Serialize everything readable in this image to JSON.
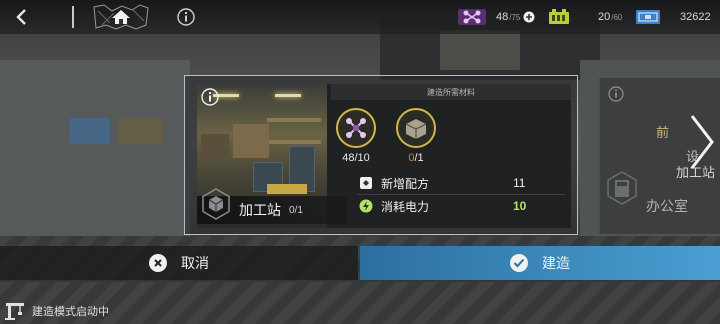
{
  "topbar": {
    "resource1": {
      "value": "48",
      "max": "/75",
      "icon": "drone-icon"
    },
    "resource2": {
      "value": "20",
      "max": "/60",
      "icon": "battery-icon"
    },
    "resource3": {
      "value": "32622",
      "icon": "currency-icon"
    }
  },
  "dialog": {
    "header": "建造所需材料",
    "materials": [
      {
        "count": "48/10",
        "icon": "drone-material-icon"
      },
      {
        "count_current": "0",
        "count_required": "/1",
        "icon": "crate-material-icon"
      }
    ],
    "facility_name": "加工站",
    "facility_level": "0/1",
    "stats": [
      {
        "label": "新增配方",
        "value": "11",
        "icon": "recipe-icon"
      },
      {
        "label": "消耗电力",
        "value": "10",
        "icon": "power-icon"
      }
    ]
  },
  "next_card": {
    "line1": "前",
    "line2": "设",
    "line3": "加工站",
    "name": "办公室"
  },
  "actions": {
    "cancel_label": "取消",
    "build_label": "建造"
  },
  "status": {
    "text": "建造模式启动中"
  },
  "colors": {
    "accent_blue": "#4a9fd3",
    "power_green": "#b7e16a",
    "material_red": "#e07c38",
    "gold": "#d2b64a"
  }
}
